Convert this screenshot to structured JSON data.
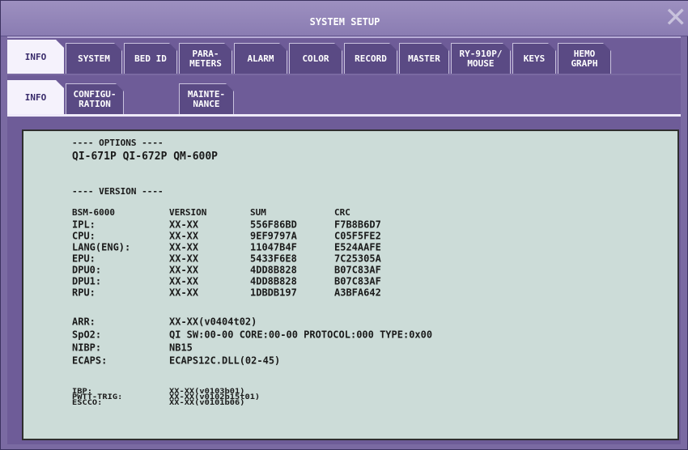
{
  "window": {
    "title": "SYSTEM SETUP"
  },
  "main_tabs": [
    {
      "label": "INFO",
      "active": true
    },
    {
      "label": "SYSTEM",
      "active": false
    },
    {
      "label": "BED ID",
      "active": false
    },
    {
      "label": "PARA-\nMETERS",
      "active": false
    },
    {
      "label": "ALARM",
      "active": false
    },
    {
      "label": "COLOR",
      "active": false
    },
    {
      "label": "RECORD",
      "active": false
    },
    {
      "label": "MASTER",
      "active": false
    },
    {
      "label": "RY-910P/\nMOUSE",
      "active": false
    },
    {
      "label": "KEYS",
      "active": false
    },
    {
      "label": "HEMO\nGRAPH",
      "active": false
    }
  ],
  "sub_tabs": [
    {
      "label": "INFO",
      "active": true
    },
    {
      "label": "CONFIGU-\nRATION",
      "active": false
    },
    {
      "label": "MAINTE-\nNANCE",
      "active": false
    }
  ],
  "options": {
    "header": "---- OPTIONS ----",
    "items": "QI-671P QI-672P QM-600P"
  },
  "version": {
    "header": "---- VERSION ----",
    "columns": [
      "BSM-6000",
      "VERSION",
      "SUM",
      "CRC"
    ],
    "rows": [
      [
        "IPL:",
        "XX-XX",
        "556F86BD",
        "F7B8B6D7"
      ],
      [
        "CPU:",
        "XX-XX",
        "9EF9797A",
        "C05F5FE2"
      ],
      [
        "LANG(ENG):",
        "XX-XX",
        "11047B4F",
        "E524AAFE"
      ],
      [
        "EPU:",
        "XX-XX",
        "5433F6E8",
        "7C25305A"
      ],
      [
        "DPU0:",
        "XX-XX",
        "4DD8B828",
        "B07C83AF"
      ],
      [
        "DPU1:",
        "XX-XX",
        "4DD8B828",
        "B07C83AF"
      ],
      [
        "RPU:",
        "XX-XX",
        "1DBDB197",
        "A3BFA642"
      ]
    ]
  },
  "modules": [
    [
      "ARR:",
      "XX-XX(v0404t02)"
    ],
    [
      "SpO2:",
      "QI SW:00-00 CORE:00-00 PROTOCOL:000 TYPE:0x00"
    ],
    [
      "NIBP:",
      "NB15"
    ],
    [
      "ECAPS:",
      "ECAPS12C.DLL(02-45)"
    ]
  ],
  "misc": [
    [
      "IBP:",
      "XX-XX(v0103b01)"
    ],
    [
      "PWTT-TRIG:",
      "XX-XX(v0102b15t01)"
    ],
    [
      "ESCCO:",
      "XX-XX(v0101b06)"
    ]
  ]
}
